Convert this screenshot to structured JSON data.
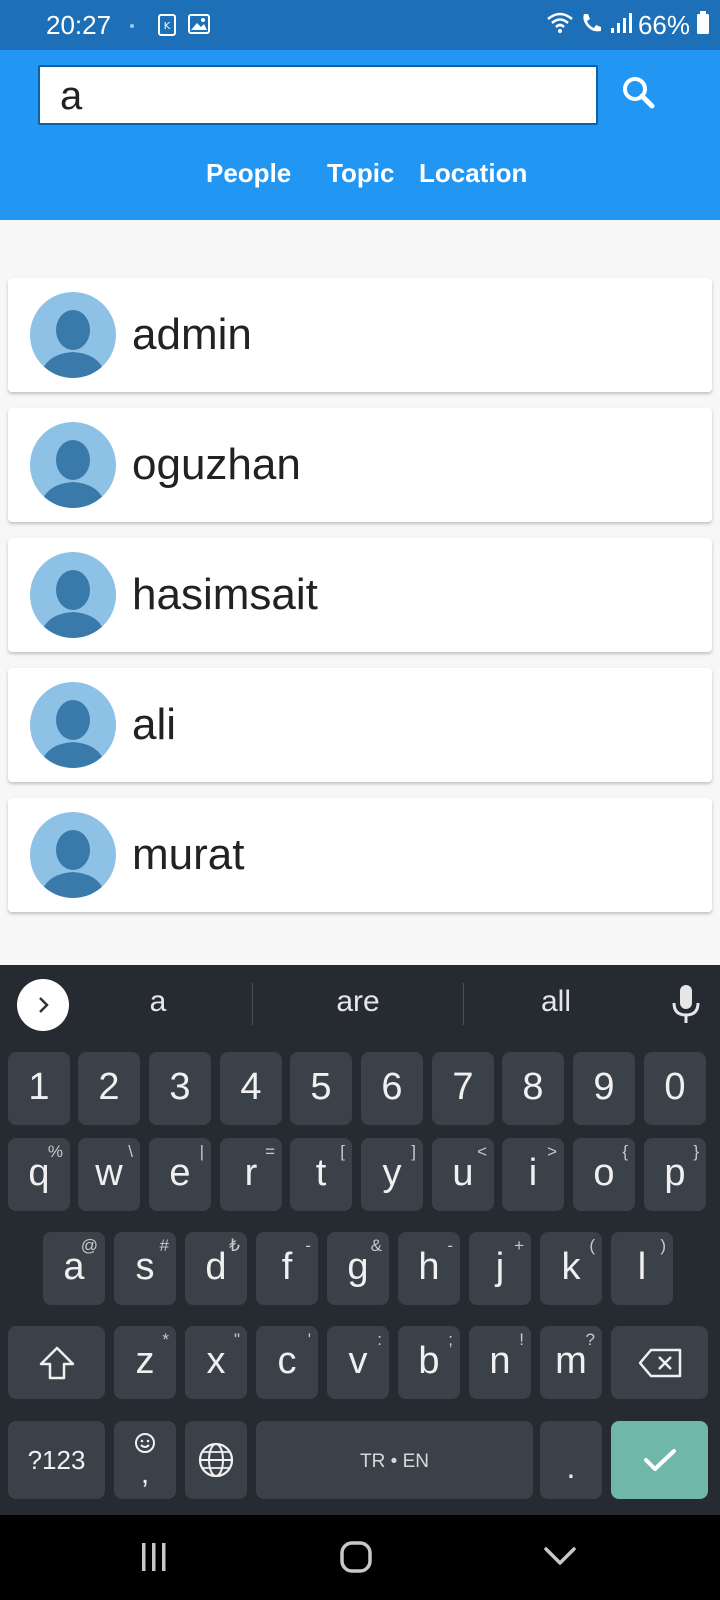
{
  "status_bar": {
    "time": "20:27",
    "battery": "66%",
    "icons": [
      "notification-k-icon",
      "gallery-icon",
      "wifi-icon",
      "wifi-call-icon",
      "signal-icon",
      "battery-icon"
    ]
  },
  "search": {
    "query": "a",
    "tabs": [
      "People",
      "Topic",
      "Location"
    ]
  },
  "results": [
    {
      "name": "admin"
    },
    {
      "name": "oguzhan"
    },
    {
      "name": "hasimsait"
    },
    {
      "name": "ali"
    },
    {
      "name": "murat"
    }
  ],
  "keyboard": {
    "suggestions": [
      "a",
      "are",
      "all"
    ],
    "number_row": [
      "1",
      "2",
      "3",
      "4",
      "5",
      "6",
      "7",
      "8",
      "9",
      "0"
    ],
    "row1": [
      {
        "key": "q",
        "alt": "%"
      },
      {
        "key": "w",
        "alt": "\\"
      },
      {
        "key": "e",
        "alt": "|"
      },
      {
        "key": "r",
        "alt": "="
      },
      {
        "key": "t",
        "alt": "["
      },
      {
        "key": "y",
        "alt": "]"
      },
      {
        "key": "u",
        "alt": "<"
      },
      {
        "key": "i",
        "alt": ">"
      },
      {
        "key": "o",
        "alt": "{"
      },
      {
        "key": "p",
        "alt": "}"
      }
    ],
    "row2": [
      {
        "key": "a",
        "alt": "@"
      },
      {
        "key": "s",
        "alt": "#"
      },
      {
        "key": "d",
        "alt": "₺"
      },
      {
        "key": "f",
        "alt": "-"
      },
      {
        "key": "g",
        "alt": "&"
      },
      {
        "key": "h",
        "alt": "-"
      },
      {
        "key": "j",
        "alt": "+"
      },
      {
        "key": "k",
        "alt": "("
      },
      {
        "key": "l",
        "alt": ")"
      }
    ],
    "row3": [
      {
        "key": "z",
        "alt": "*"
      },
      {
        "key": "x",
        "alt": "\""
      },
      {
        "key": "c",
        "alt": "'"
      },
      {
        "key": "v",
        "alt": ":"
      },
      {
        "key": "b",
        "alt": ";"
      },
      {
        "key": "n",
        "alt": "!"
      },
      {
        "key": "m",
        "alt": "?"
      }
    ],
    "symbols_label": "?123",
    "comma_label": ",",
    "space_label": "TR • EN",
    "period_label": "."
  },
  "colors": {
    "header": "#2196f3",
    "status_bar": "#1d6fb8",
    "keyboard_bg": "#262b31",
    "key_bg": "#3b4149",
    "enter_key": "#6fb8a9",
    "avatar_bg": "#8ec1e6",
    "avatar_fg": "#3a7aab"
  }
}
